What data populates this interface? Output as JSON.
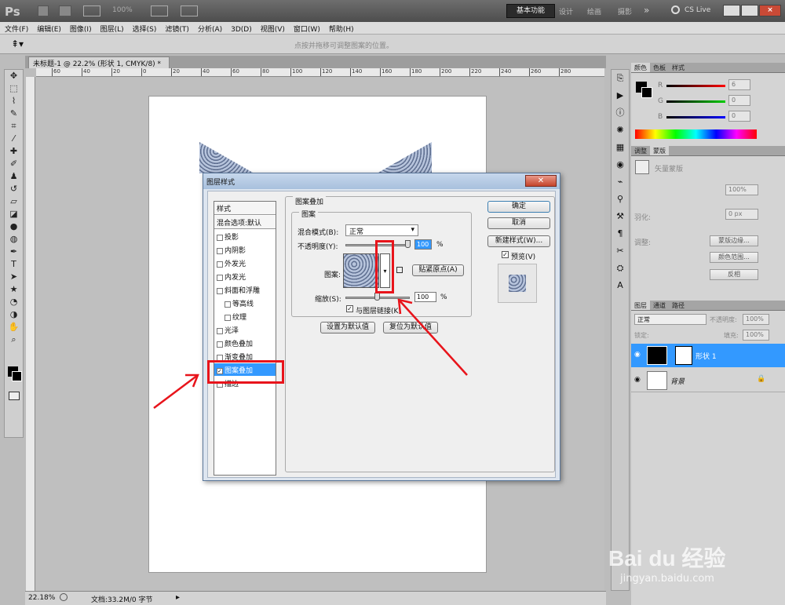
{
  "app": {
    "logo": "Ps",
    "zoom_box": "100%",
    "workspaces": [
      "基本功能",
      "设计",
      "绘画",
      "摄影"
    ],
    "more_label": "»",
    "cslive": "CS Live"
  },
  "menu": [
    "文件(F)",
    "编辑(E)",
    "图像(I)",
    "图层(L)",
    "选择(S)",
    "滤镜(T)",
    "分析(A)",
    "3D(D)",
    "视图(V)",
    "窗口(W)",
    "帮助(H)"
  ],
  "options_hint": "点按并拖移可调整图案的位置。",
  "document": {
    "tab_title": "未标题-1 @ 22.2% (形状 1, CMYK/8) *",
    "ruler_ticks": [
      "60",
      "40",
      "20",
      "0",
      "20",
      "40",
      "60",
      "80",
      "100",
      "120",
      "140",
      "160",
      "180",
      "200",
      "220",
      "240",
      "260",
      "280"
    ],
    "zoom": "22.18%",
    "doc_info": "文档:33.2M/0 字节"
  },
  "dialog": {
    "title": "图层样式",
    "styles_header": "样式",
    "blend_options": "混合选项:默认",
    "style_items": [
      {
        "label": "投影",
        "checked": false,
        "indent": false
      },
      {
        "label": "内阴影",
        "checked": false,
        "indent": false
      },
      {
        "label": "外发光",
        "checked": false,
        "indent": false
      },
      {
        "label": "内发光",
        "checked": false,
        "indent": false
      },
      {
        "label": "斜面和浮雕",
        "checked": false,
        "indent": false
      },
      {
        "label": "等高线",
        "checked": false,
        "indent": true
      },
      {
        "label": "纹理",
        "checked": false,
        "indent": true
      },
      {
        "label": "光泽",
        "checked": false,
        "indent": false
      },
      {
        "label": "颜色叠加",
        "checked": false,
        "indent": false
      },
      {
        "label": "渐变叠加",
        "checked": false,
        "indent": false
      },
      {
        "label": "图案叠加",
        "checked": true,
        "indent": false,
        "selected": true
      },
      {
        "label": "描边",
        "checked": false,
        "indent": false
      }
    ],
    "section_title": "图案叠加",
    "group_title": "图案",
    "blend_mode_label": "混合模式(B):",
    "blend_mode_value": "正常",
    "opacity_label": "不透明度(Y):",
    "opacity_value": "100",
    "opacity_unit": "%",
    "pattern_label": "图案:",
    "snap_origin": "贴紧原点(A)",
    "scale_label": "缩放(S):",
    "scale_value": "100",
    "scale_unit": "%",
    "link_label": "与图层链接(K)",
    "set_default": "设置为默认值",
    "reset_default": "复位为默认值",
    "ok": "确定",
    "cancel": "取消",
    "new_style": "新建样式(W)...",
    "preview": "预览(V)",
    "close_icon": "close-icon"
  },
  "color_panel": {
    "tabs": [
      "颜色",
      "色板",
      "样式"
    ],
    "r_label": "R",
    "g_label": "G",
    "b_label": "B",
    "r": "6",
    "g": "0",
    "b": "0"
  },
  "adjust_panel": {
    "tabs": [
      "调整",
      "蒙版"
    ],
    "mask_label": "矢量蒙版",
    "density": "100%",
    "feather_label": "羽化:",
    "feather": "0 px",
    "refine_label": "调整:",
    "btn_mask_edge": "蒙版边缘...",
    "btn_color_range": "颜色范围...",
    "btn_invert": "反相"
  },
  "layers_panel": {
    "tabs": [
      "图层",
      "通道",
      "路径"
    ],
    "blend": "正常",
    "opacity_label": "不透明度:",
    "opacity": "100%",
    "lock_label": "锁定:",
    "fill_label": "填充:",
    "fill": "100%",
    "layers": [
      {
        "name": "形状 1",
        "selected": true
      },
      {
        "name": "背景",
        "selected": false
      }
    ]
  },
  "watermark": {
    "brand": "Bai du 经验",
    "url": "jingyan.baidu.com"
  }
}
